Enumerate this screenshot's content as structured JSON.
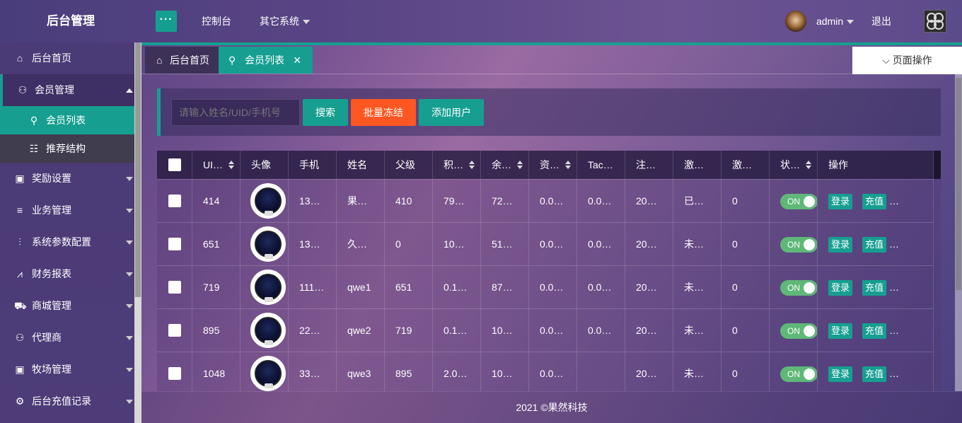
{
  "header": {
    "logo": "后台管理",
    "menu_toggle": "···",
    "nav": [
      "控制台",
      "其它系统"
    ],
    "user": "admin",
    "logout": "退出"
  },
  "sidebar": {
    "items": [
      {
        "label": "后台首页",
        "icon": "home-icon"
      },
      {
        "label": "会员管理",
        "icon": "user-icon",
        "expanded": true
      },
      {
        "label": "会员列表",
        "icon": "user-list-icon",
        "sub": true,
        "active": true
      },
      {
        "label": "推荐结构",
        "icon": "tree-icon",
        "sub": true
      },
      {
        "label": "奖励设置",
        "icon": "gift-icon"
      },
      {
        "label": "业务管理",
        "icon": "list-icon"
      },
      {
        "label": "系统参数配置",
        "icon": "sliders-icon"
      },
      {
        "label": "财务报表",
        "icon": "chart-icon"
      },
      {
        "label": "商城管理",
        "icon": "shop-icon"
      },
      {
        "label": "代理商",
        "icon": "agent-icon"
      },
      {
        "label": "牧场管理",
        "icon": "ranch-icon"
      },
      {
        "label": "后台充值记录",
        "icon": "gear-icon"
      }
    ]
  },
  "tabs": {
    "home": "后台首页",
    "active": "会员列表",
    "page_ops": "页面操作"
  },
  "search": {
    "placeholder": "请输入姓名/UID/手机号",
    "search_btn": "搜索",
    "freeze_btn": "批量冻结",
    "add_btn": "添加用户"
  },
  "table": {
    "headers": [
      "UI…",
      "头像",
      "手机",
      "姓名",
      "父级",
      "积…",
      "余…",
      "资…",
      "Tac…",
      "注…",
      "激…",
      "激…",
      "状…",
      "操作"
    ],
    "rows": [
      {
        "uid": "414",
        "phone": "13…",
        "name": "果…",
        "parent": "410",
        "points": "79…",
        "balance": "72…",
        "asset": "0.0…",
        "tac": "0.0…",
        "reg": "20…",
        "act": "已…",
        "act2": "0",
        "status": "ON"
      },
      {
        "uid": "651",
        "phone": "13…",
        "name": "久…",
        "parent": "0",
        "points": "10…",
        "balance": "51…",
        "asset": "0.0…",
        "tac": "0.0…",
        "reg": "20…",
        "act": "未…",
        "act2": "0",
        "status": "ON"
      },
      {
        "uid": "719",
        "phone": "111…",
        "name": "qwe1",
        "parent": "651",
        "points": "0.1…",
        "balance": "87…",
        "asset": "0.0…",
        "tac": "0.0…",
        "reg": "20…",
        "act": "未…",
        "act2": "0",
        "status": "ON"
      },
      {
        "uid": "895",
        "phone": "22…",
        "name": "qwe2",
        "parent": "719",
        "points": "0.1…",
        "balance": "10…",
        "asset": "0.0…",
        "tac": "0.0…",
        "reg": "20…",
        "act": "未…",
        "act2": "0",
        "status": "ON"
      },
      {
        "uid": "1048",
        "phone": "33…",
        "name": "qwe3",
        "parent": "895",
        "points": "2.0…",
        "balance": "10…",
        "asset": "0.0…",
        "tac": "",
        "reg": "20…",
        "act": "未…",
        "act2": "0",
        "status": "ON"
      }
    ],
    "login_btn": "登录",
    "recharge_btn": "充值",
    "more": "…"
  },
  "footer": "2021 ©果然科技",
  "colors": {
    "accent": "#169f91",
    "danger": "#ff5722",
    "switch_on": "#5fb878"
  }
}
